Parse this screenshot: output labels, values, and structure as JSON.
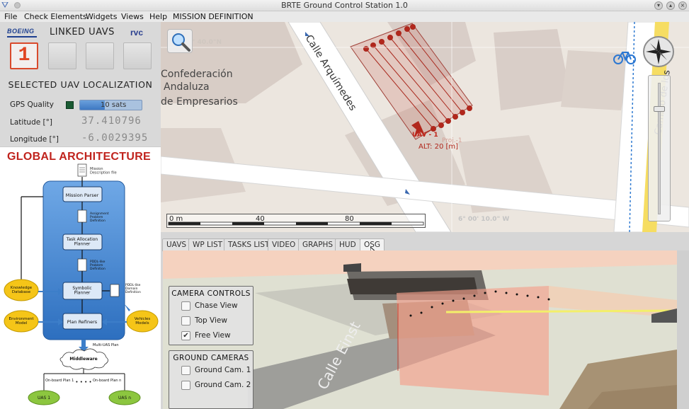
{
  "window": {
    "title": "BRTE Ground Control Station 1.0"
  },
  "menu": [
    "File",
    "Check Elements",
    "Widgets",
    "Views",
    "Help",
    "MISSION DEFINITION"
  ],
  "uav_panel": {
    "boeing_logo": "BOEING",
    "linked_title": "LINKED UAVS",
    "rvc_logo": "rvc",
    "slots": [
      "1",
      "",
      "",
      ""
    ],
    "selected_title": "SELECTED UAV LOCALIZATION",
    "gps_label": "GPS Quality",
    "gps_value": "10 sats",
    "gps_fraction": 0.4,
    "lat_label": "Latitude [°]",
    "lat_value": "37.410796",
    "lon_label": "Longitude [°]",
    "lon_value": "-6.0029395"
  },
  "architecture": {
    "title": "GLOBAL ARCHITECTURE",
    "mission_file": "Mission\nDescription file",
    "mission_parser": "Mission Parser",
    "assignment": "Assignment\nProblem\nDefinition",
    "task_alloc": "Task Allocation\nPlanner",
    "pddl_problem": "PDDL-like\nProblem\nDefinition",
    "symbolic": "Symbolic\nPlanner",
    "pddl_domain": "PDDL-like\nDomain\nDefinition",
    "plan_refiners": "Plan Refiners",
    "knowledge": "Knowledge\nDatabase",
    "environment": "Environment\nModel",
    "vehicles": "Vehicles\nModels",
    "multi_uas": "Multi-UAS Plan",
    "middleware": "Middleware",
    "onboard_1": "On-board Plan 1",
    "onboard_n": "On-board Plan n",
    "dots": "• • • •",
    "uas_1": "UAS 1",
    "uas_n": "UAS n"
  },
  "map": {
    "lat_label": "° 40.0\"N",
    "lon_label": "6° 00' 10.0\" W",
    "street_1": "Calle Arquímedes",
    "street_2": "Camino de los",
    "place_1": "Confederación",
    "place_2": "Andaluza",
    "place_3": "de Empresarios",
    "uav_label": "UAV - 1",
    "uav_proj": "Proj.-1",
    "uav_alt": "ALT: 20 [m]",
    "scale_0": "0 m",
    "scale_40": "40",
    "scale_80": "80"
  },
  "tabs": [
    "UAVS",
    "WP LIST",
    "TASKS LIST",
    "VIDEO",
    "GRAPHS",
    "HUD",
    "OSG"
  ],
  "active_tab": "OSG",
  "camera_controls": {
    "title": "CAMERA CONTROLS",
    "options": [
      {
        "label": "Chase View",
        "checked": false
      },
      {
        "label": "Top View",
        "checked": false
      },
      {
        "label": "Free View",
        "checked": true
      }
    ]
  },
  "ground_cameras": {
    "title": "GROUND CAMERAS",
    "options": [
      {
        "label": "Ground Cam. 1",
        "checked": false
      },
      {
        "label": "Ground Cam. 2",
        "checked": false
      }
    ]
  },
  "scene": {
    "street_label": "Calle Einst"
  },
  "colors": {
    "accent_red": "#e04623",
    "uav_path": "#c0261b",
    "arch_blue": "#3c7ec9",
    "arch_yellow": "#f5c518"
  }
}
